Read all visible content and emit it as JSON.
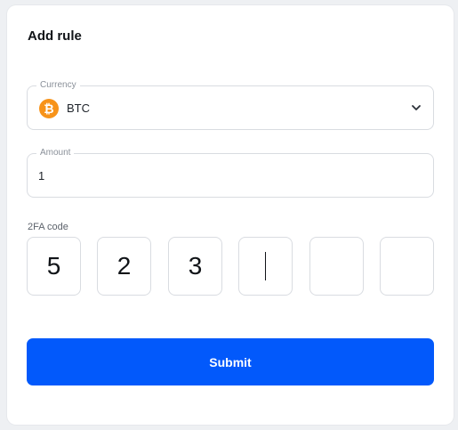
{
  "form": {
    "title": "Add rule",
    "currency": {
      "label": "Currency",
      "value": "BTC",
      "icon": "bitcoin-icon",
      "icon_glyph": "₿",
      "icon_color": "#f7931a"
    },
    "amount": {
      "label": "Amount",
      "value": "1"
    },
    "twofa": {
      "label": "2FA code",
      "digits": [
        "5",
        "2",
        "3",
        "",
        "",
        ""
      ]
    },
    "submit_label": "Submit",
    "accent_color": "#0259fb"
  }
}
